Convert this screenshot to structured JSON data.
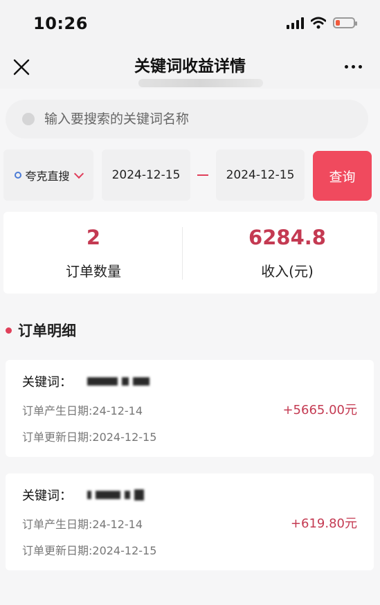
{
  "status_bar": {
    "time": "10:26"
  },
  "nav": {
    "title": "关键词收益详情"
  },
  "search": {
    "placeholder": "输入要搜索的关键词名称",
    "value": ""
  },
  "filter": {
    "platform": "夸克直搜",
    "start_date": "2024-12-15",
    "end_date": "2024-12-15",
    "query_label": "查询"
  },
  "stats": {
    "order_count": "2",
    "order_count_label": "订单数量",
    "income": "6284.8",
    "income_label": "收入(元)"
  },
  "section": {
    "title": "订单明细"
  },
  "orders": [
    {
      "keyword_label": "关键词：",
      "created_text": "订单产生日期:24-12-14",
      "updated_text": "订单更新日期:2024-12-15",
      "amount": "+5665.00元"
    },
    {
      "keyword_label": "关键词：",
      "created_text": "订单产生日期:24-12-14",
      "updated_text": "订单更新日期:2024-12-15",
      "amount": "+619.80元"
    }
  ],
  "colors": {
    "accent": "#f04a5e",
    "amount": "#c43a52",
    "background": "#f6f6f7"
  }
}
